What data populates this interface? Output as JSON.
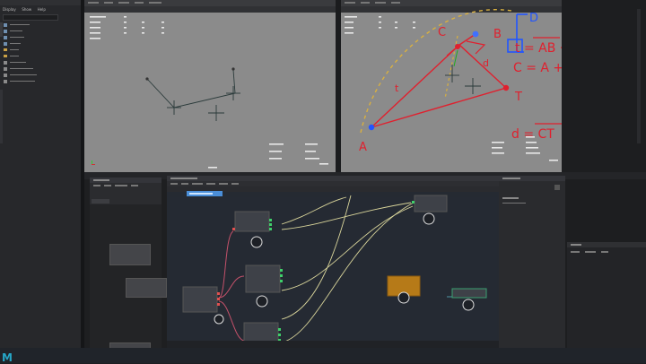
{
  "outliner": {
    "menu": [
      "Display",
      "Show",
      "Help"
    ]
  },
  "viewport_right": {
    "annotations": {
      "labels": [
        "C",
        "B",
        "A",
        "T",
        "t",
        "d"
      ],
      "formulas": [
        "D",
        "t = AB · AT",
        "C = A + t",
        "d = CT"
      ]
    }
  },
  "brand": {
    "logo": "M"
  },
  "colors": {
    "annotation_red": "#e0202e",
    "annotation_yellow": "#d9b040",
    "annotation_blue": "#2255ff",
    "node_orange": "#b67a18",
    "wire": "#d8d49a"
  },
  "icons": [
    "cube-icon",
    "folder-icon",
    "close-icon",
    "play-icon",
    "add-icon"
  ]
}
